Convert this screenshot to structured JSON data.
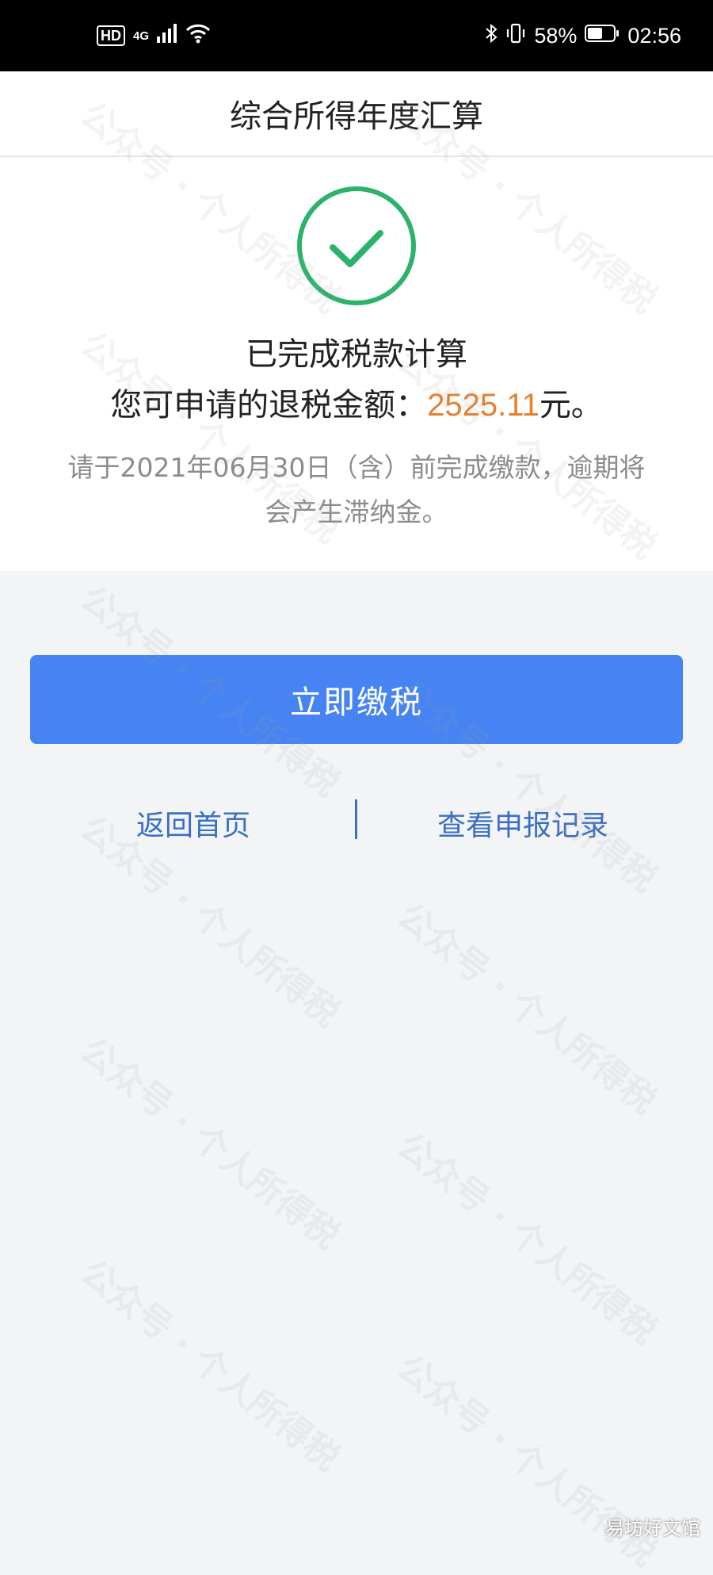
{
  "status_bar": {
    "hd": "HD",
    "network": "4G",
    "signal_icon": "signal-icon",
    "wifi_icon": "wifi-icon",
    "bluetooth_icon": "bluetooth-icon",
    "vibrate_icon": "vibrate-icon",
    "battery_percent": "58%",
    "battery_level": 0.58,
    "time": "02:56"
  },
  "header": {
    "title": "综合所得年度汇算"
  },
  "result": {
    "icon": "check-circle-icon",
    "headline": "已完成税款计算",
    "refund_prefix": "您可申请的退税金额：",
    "refund_amount": "2525.11",
    "refund_suffix": "元。",
    "notice": "请于2021年06月30日（含）前完成缴款，逾期将会产生滞纳金。"
  },
  "actions": {
    "pay_button": "立即缴税",
    "home_link": "返回首页",
    "records_link": "查看申报记录"
  },
  "colors": {
    "accent": "#4584f2",
    "link": "#3a6fc4",
    "amount": "#e7802c",
    "check": "#2cb36b"
  },
  "watermarks": {
    "repeat": "公众号 · 个人所得税",
    "site": "易坊好文馆"
  }
}
